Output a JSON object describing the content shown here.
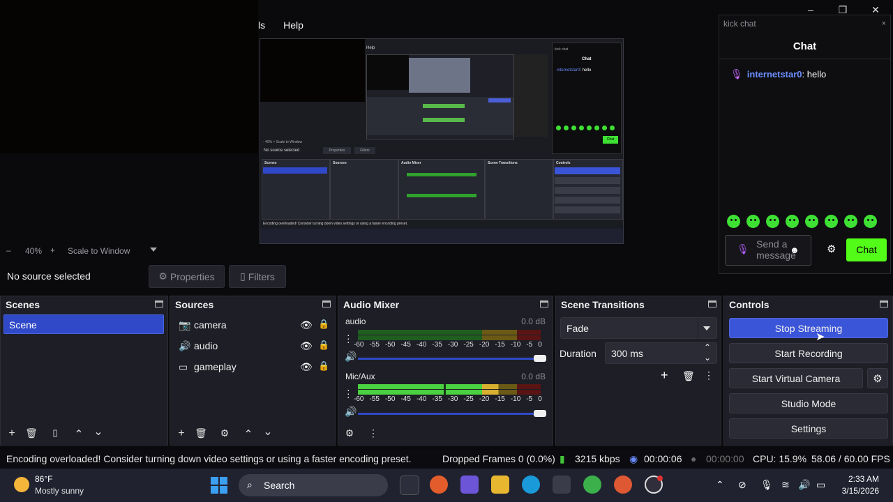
{
  "window": {
    "menu_partial": "ls",
    "menu_help": "Help",
    "controls": [
      "–",
      "❐",
      "✕"
    ]
  },
  "preview": {
    "help": "Help",
    "zoom_row": "- 40% + Scale to Window",
    "no_source": "No source selected",
    "properties": "Properties",
    "filters": "Filters",
    "scenes": "Scenes",
    "sources": "Sources",
    "audio_mixer": "Audio Mixer",
    "scene_transitions": "Scene Transitions",
    "controls": "Controls",
    "chat_tab": "kick chat",
    "chat_title": "Chat",
    "chat_user": "internetstar0",
    "chat_text": ": hello",
    "chat_btn": "Chat",
    "status": "Encoding overloaded! Consider turning down video settings or using a faster encoding preset."
  },
  "zoom": {
    "minus": "–",
    "percent": "40%",
    "plus": "+",
    "mode": "Scale to Window"
  },
  "source_bar": {
    "no_source": "No source selected",
    "properties": "Properties",
    "filters": "Filters"
  },
  "scenes": {
    "title": "Scenes",
    "items": [
      "Scene"
    ]
  },
  "sources": {
    "title": "Sources",
    "items": [
      {
        "icon": "camera-icon",
        "label": "camera"
      },
      {
        "icon": "speaker-icon",
        "label": "audio"
      },
      {
        "icon": "display-icon",
        "label": "gameplay"
      }
    ]
  },
  "mixer": {
    "title": "Audio Mixer",
    "ticks": [
      "-60",
      "-55",
      "-50",
      "-45",
      "-40",
      "-35",
      "-30",
      "-25",
      "-20",
      "-15",
      "-10",
      "-5",
      "0"
    ],
    "channels": [
      {
        "name": "audio",
        "db": "0.0 dB",
        "level": 0.0
      },
      {
        "name": "Mic/Aux",
        "db": "0.0 dB",
        "level": 0.75
      }
    ]
  },
  "transitions": {
    "title": "Scene Transitions",
    "selected": "Fade",
    "duration_label": "Duration",
    "duration_value": "300 ms"
  },
  "controls": {
    "title": "Controls",
    "stop_streaming": "Stop Streaming",
    "start_recording": "Start Recording",
    "start_virtual_camera": "Start Virtual Camera",
    "studio_mode": "Studio Mode",
    "settings": "Settings"
  },
  "status": {
    "message": "Encoding overloaded! Consider turning down video settings or using a faster encoding preset.",
    "dropped": "Dropped Frames 0 (0.0%)",
    "bitrate": "3215 kbps",
    "stream_time": "00:00:06",
    "rec_time": "00:00:00",
    "cpu": "CPU: 15.9%",
    "fps": "58.06 / 60.00 FPS"
  },
  "chat": {
    "tab_title": "kick chat",
    "close": "×",
    "title": "Chat",
    "username": "internetstar0",
    "message": ": hello",
    "placeholder": "Send a message",
    "send": "Chat"
  },
  "taskbar": {
    "temp": "86°F",
    "weather": "Mostly sunny",
    "search": "Search",
    "time": "2:33 AM",
    "date": "3/15/2026"
  },
  "colors": {
    "accent": "#3b55d8",
    "kick_green": "#53fc18",
    "meter_green": "#2fa12c"
  }
}
